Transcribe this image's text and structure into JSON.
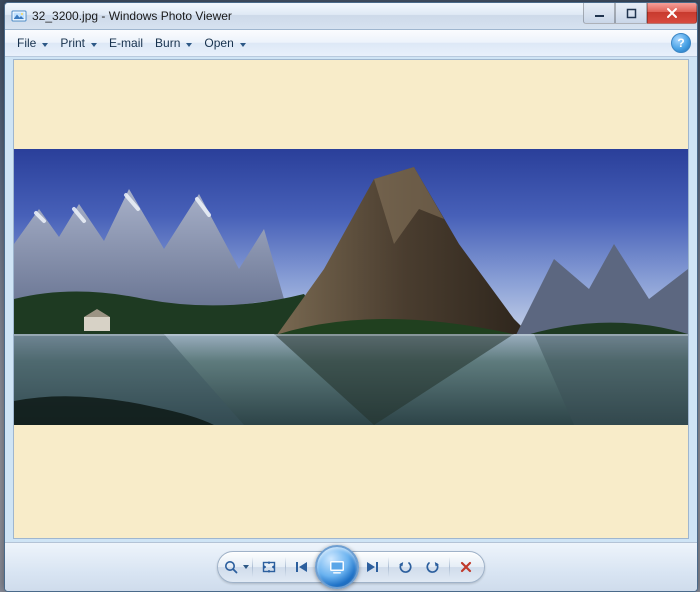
{
  "window": {
    "title": "32_3200.jpg - Windows Photo Viewer",
    "app_icon": "photo-viewer-icon"
  },
  "menu": {
    "items": [
      {
        "label": "File",
        "has_dropdown": true
      },
      {
        "label": "Print",
        "has_dropdown": true
      },
      {
        "label": "E-mail",
        "has_dropdown": false
      },
      {
        "label": "Burn",
        "has_dropdown": true
      },
      {
        "label": "Open",
        "has_dropdown": true
      }
    ],
    "help_label": "?"
  },
  "viewport": {
    "background_color": "#f8ecc9",
    "image_description": "Panoramic landscape: mountain range with a prominent peak reflected in a calm lake, blue sky."
  },
  "controls": {
    "zoom_label": "Change the display size",
    "fit_label": "Actual size",
    "previous_label": "Previous",
    "slideshow_label": "Play slide show",
    "next_label": "Next",
    "rotate_ccw_label": "Rotate counterclockwise",
    "rotate_cw_label": "Rotate clockwise",
    "delete_label": "Delete"
  },
  "colors": {
    "accent": "#2c5f9e",
    "close": "#d74a3e"
  }
}
